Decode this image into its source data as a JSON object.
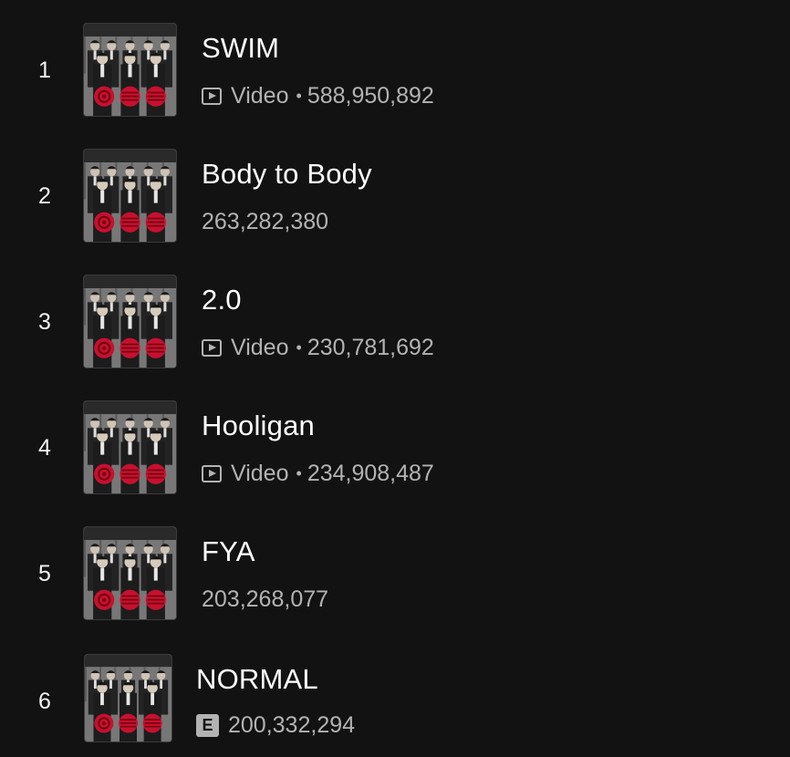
{
  "tracks": [
    {
      "rank": "1",
      "title": "SWIM",
      "type_label": "Video",
      "streams": "588,950,892",
      "has_video": true,
      "explicit": false
    },
    {
      "rank": "2",
      "title": "Body to Body",
      "type_label": "",
      "streams": "263,282,380",
      "has_video": false,
      "explicit": false
    },
    {
      "rank": "3",
      "title": "2.0",
      "type_label": "Video",
      "streams": "230,781,692",
      "has_video": true,
      "explicit": false
    },
    {
      "rank": "4",
      "title": "Hooligan",
      "type_label": "Video",
      "streams": "234,908,487",
      "has_video": true,
      "explicit": false
    },
    {
      "rank": "5",
      "title": "FYA",
      "type_label": "",
      "streams": "203,268,077",
      "has_video": false,
      "explicit": false
    },
    {
      "rank": "6",
      "title": "NORMAL",
      "type_label": "",
      "streams": "200,332,294",
      "has_video": false,
      "explicit": true,
      "explicit_label": "E"
    }
  ],
  "separator": "•",
  "colors": {
    "background": "#121212",
    "primary_text": "#ffffff",
    "secondary_text": "#b3b3b3",
    "cover_accent": "#c8102e"
  }
}
